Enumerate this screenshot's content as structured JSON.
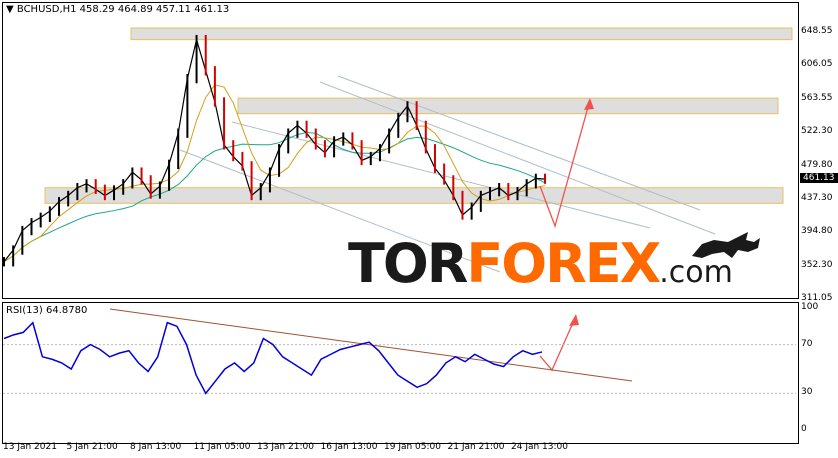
{
  "header": {
    "symbol_line": "BCHUSD,H1  458.29 464.89 457.11 461.13"
  },
  "current_price": "461.13",
  "price_axis": [
    "648.55",
    "606.05",
    "563.55",
    "522.30",
    "479.80",
    "437.30",
    "394.80",
    "352.30",
    "311.05"
  ],
  "rsi": {
    "title": "RSI(13) 64.8780",
    "levels": [
      "100",
      "70",
      "30",
      "0"
    ]
  },
  "time_axis": [
    "13 Jan 2021",
    "5 Jan 21:00",
    "8 Jan 13:00",
    "11 Jan 05:00",
    "13 Jan 21:00",
    "16 Jan 13:00",
    "19 Jan 05:00",
    "21 Jan 21:00",
    "24 Jan 13:00"
  ],
  "watermark": {
    "part1": "TOR",
    "part2": "FOREX",
    "part3": ".com"
  },
  "colors": {
    "candles": "#d40000",
    "price_line": "#000000",
    "ma_fast": "#d4a017",
    "ma_slow": "#1aa98a",
    "rsi_line": "#0000dd",
    "zone_fill": "#dedede",
    "zone_border": "#e8c060",
    "trend_line": "#b0bec8",
    "arrow": "#ef5350",
    "rsi_trend": "#a0522d"
  },
  "chart_data": {
    "type": "line",
    "title": "BCHUSD,H1",
    "x_range": [
      "3 Jan 2021",
      "26 Jan 2021"
    ],
    "ylim": [
      311.05,
      648.55
    ],
    "series": [
      {
        "values": [
          355,
          370,
          395,
          405,
          412,
          420,
          432,
          440,
          450,
          455,
          448,
          440,
          447,
          455,
          470,
          460,
          442,
          452,
          480,
          520,
          590,
          640,
          600,
          560,
          505,
          490,
          478,
          440,
          450,
          470,
          500,
          520,
          530,
          520,
          505,
          495,
          510,
          515,
          505,
          485,
          490,
          500,
          520,
          540,
          555,
          530,
          500,
          475,
          460,
          440,
          415,
          425,
          440,
          445,
          450,
          440,
          445,
          455,
          462,
          461
        ]
      }
    ],
    "support_zones": [
      [
        430,
        450
      ],
      [
        545,
        565
      ],
      [
        640,
        655
      ]
    ],
    "rsi_values": [
      75,
      78,
      80,
      88,
      60,
      58,
      55,
      50,
      65,
      70,
      66,
      60,
      63,
      65,
      55,
      48,
      60,
      88,
      85,
      70,
      45,
      30,
      40,
      50,
      55,
      48,
      55,
      75,
      70,
      60,
      55,
      50,
      45,
      58,
      62,
      66,
      68,
      70,
      72,
      65,
      55,
      45,
      40,
      35,
      38,
      45,
      55,
      60,
      56,
      62,
      58,
      54,
      52,
      60,
      65,
      62,
      64
    ]
  }
}
